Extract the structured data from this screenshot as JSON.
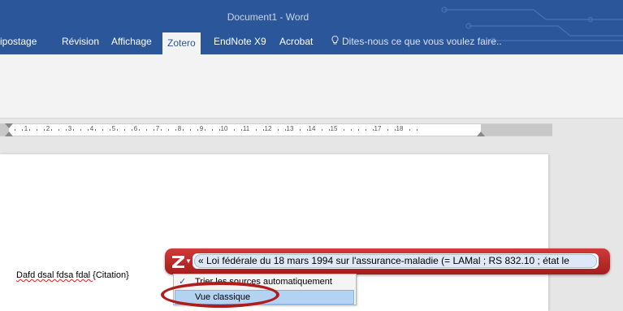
{
  "window": {
    "title": "Document1 - Word"
  },
  "ribbon": {
    "tabs": [
      {
        "label": "ipostage"
      },
      {
        "label": "Révision"
      },
      {
        "label": "Affichage"
      },
      {
        "label": "Zotero"
      },
      {
        "label": "EndNote X9"
      },
      {
        "label": "Acrobat"
      }
    ],
    "active_tab": "Zotero",
    "tell_me_placeholder": "Dites-nous ce que vous voulez faire.."
  },
  "ruler": {
    "numbers": [
      "1",
      "2",
      "3",
      "4",
      "5",
      "6",
      "7",
      "8",
      "9",
      "10",
      "11",
      "12",
      "13",
      "14",
      "15",
      "17",
      "18"
    ]
  },
  "document": {
    "text_plain": "Dafd dsal fdsa fdal ",
    "text_field": "{Citation}"
  },
  "zotero_bar": {
    "citation_text": "« Loi fédérale du 18 mars 1994 sur l'assurance-maladie (= LAMal ; RS 832.10 ; état le",
    "menu": {
      "item1_label": "Trier les sources automatiquement",
      "item1_checked": true,
      "item2_label": "Vue classique"
    }
  },
  "colors": {
    "word_blue": "#2b579a",
    "zotero_red": "#b01c1c",
    "menu_highlight": "#b4d3f3"
  }
}
